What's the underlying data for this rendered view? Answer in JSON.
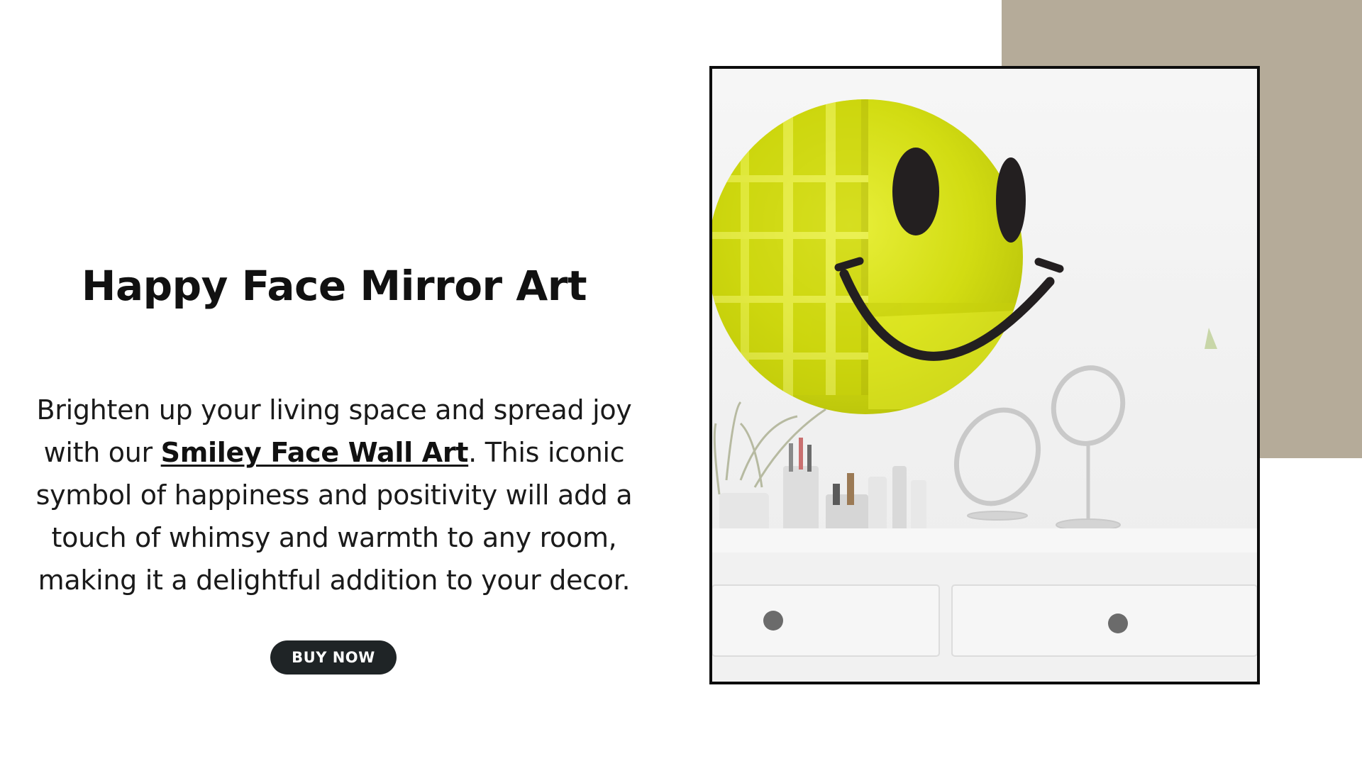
{
  "hero": {
    "title": "Happy Face Mirror Art",
    "description_before": "Brighten up your living space and spread joy with our ",
    "description_link": "Smiley Face Wall Art",
    "description_after": ". This iconic symbol of happiness and positivity will add a touch of whimsy and warmth to any room, making it a delightful addition to your decor.",
    "cta_label": "BUY NOW"
  },
  "product_image": {
    "subject": "yellow smiley face mirror on wall above white vanity"
  },
  "colors": {
    "accent_block": "#b5ab99",
    "button_bg": "#1f2426",
    "mirror_yellow": "#d6e21a",
    "frame_border": "#0d0d0d"
  }
}
